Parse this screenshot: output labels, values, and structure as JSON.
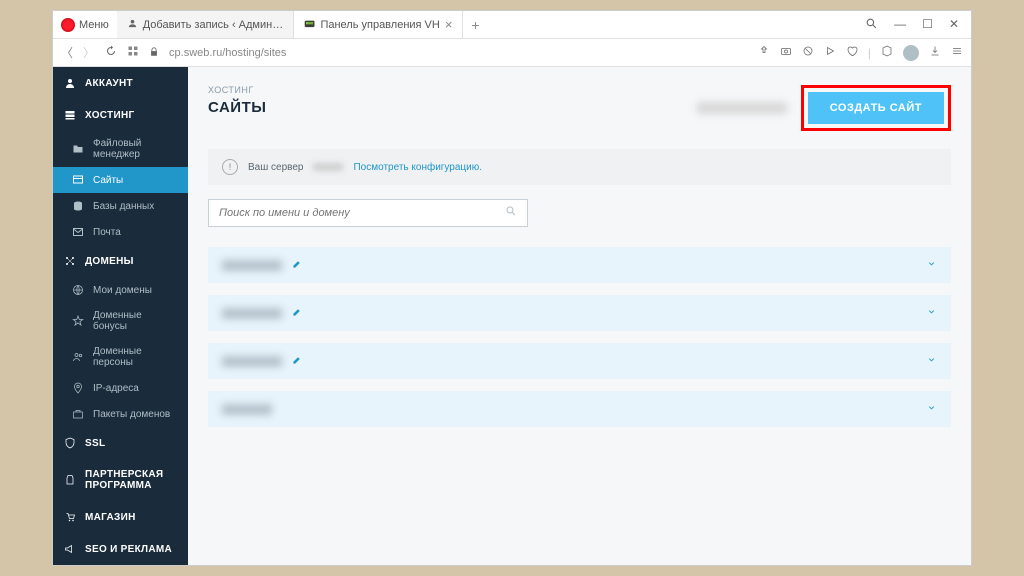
{
  "browser": {
    "menu": "Меню",
    "tab1": "Добавить запись ‹ Админ…",
    "tab2": "Панель управления VH",
    "url": "cp.sweb.ru/hosting/sites"
  },
  "sidebar": {
    "account": "АККАУНТ",
    "hosting": "ХОСТИНГ",
    "hosting_items": {
      "file_manager": "Файловый менеджер",
      "sites": "Сайты",
      "databases": "Базы данных",
      "mail": "Почта"
    },
    "domains": "ДОМЕНЫ",
    "domains_items": {
      "my_domains": "Мои домены",
      "domain_bonuses": "Доменные бонусы",
      "domain_persons": "Доменные персоны",
      "ip_addresses": "IP-адреса",
      "domain_packages": "Пакеты доменов"
    },
    "ssl": "SSL",
    "partner": "ПАРТНЕРСКАЯ ПРОГРАММА",
    "shop": "МАГАЗИН",
    "seo": "SEO И РЕКЛАМА"
  },
  "content": {
    "breadcrumb": "ХОСТИНГ",
    "title": "САЙТЫ",
    "create_btn": "СОЗДАТЬ САЙТ",
    "info_prefix": "Ваш сервер",
    "info_link": "Посмотреть конфигурацию.",
    "search_placeholder": "Поиск по имени и домену"
  }
}
